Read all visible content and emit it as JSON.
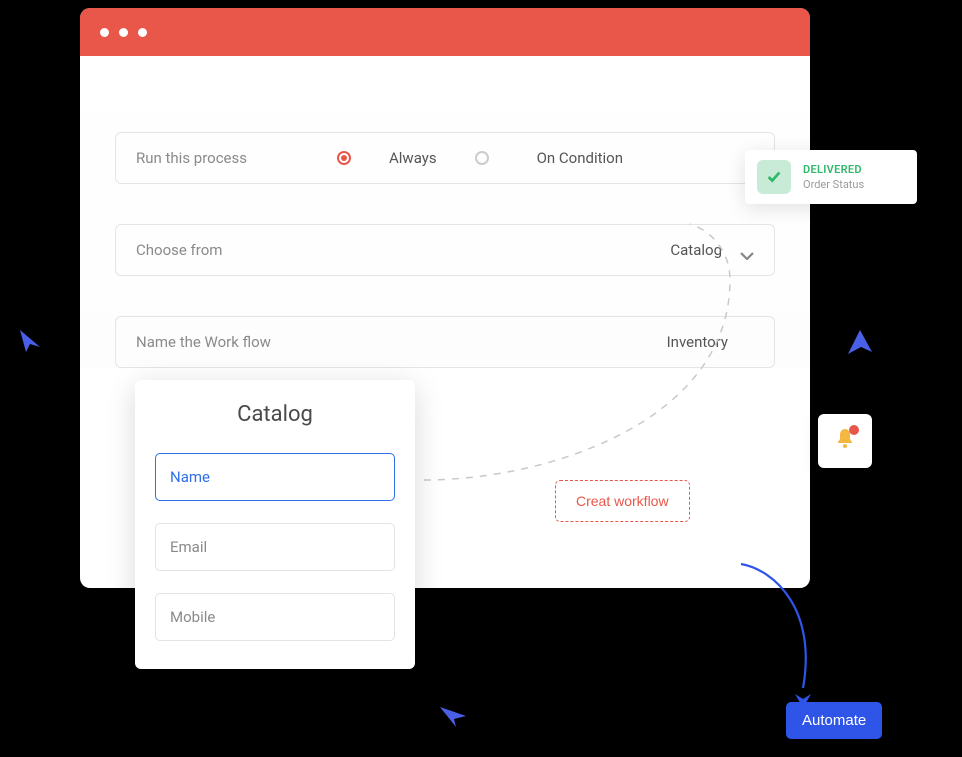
{
  "form": {
    "process_label": "Run this process",
    "option_always": "Always",
    "option_condition": "On Condition",
    "choose_label": "Choose from",
    "choose_value": "Catalog",
    "name_label": "Name the Work flow",
    "name_value": "Inventory"
  },
  "catalog": {
    "title": "Catalog",
    "fields": {
      "name": "Name",
      "email": "Email",
      "mobile": "Mobile"
    }
  },
  "buttons": {
    "create_workflow": "Creat workflow",
    "automate": "Automate"
  },
  "status_card": {
    "status": "DELIVERED",
    "subtitle": "Order Status"
  }
}
